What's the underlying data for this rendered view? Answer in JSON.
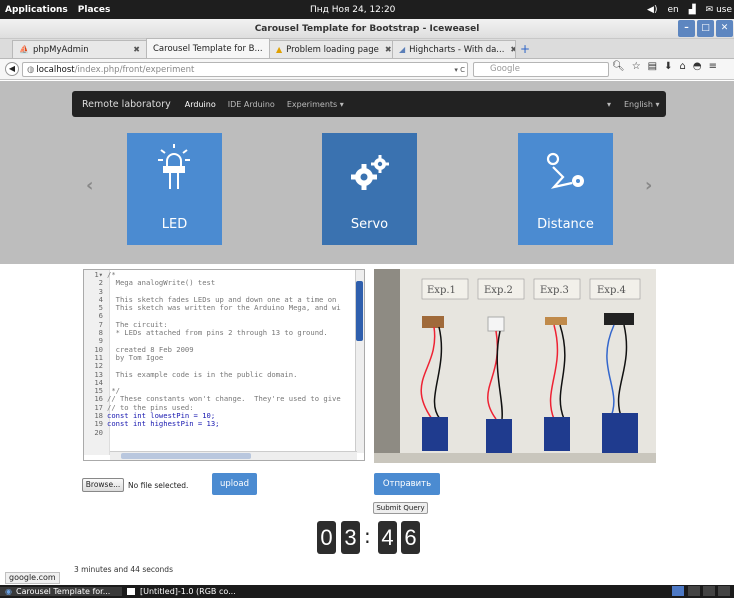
{
  "system_panel": {
    "applications": "Applications",
    "places": "Places",
    "clock": "Пнд Ноя 24, 12:20",
    "lang": "en",
    "user": "use"
  },
  "window": {
    "title": "Carousel Template for Bootstrap - Iceweasel"
  },
  "tabs": [
    {
      "label": "phpMyAdmin"
    },
    {
      "label": "Carousel Template for B..."
    },
    {
      "label": "Problem loading page"
    },
    {
      "label": "Highcharts - With da..."
    }
  ],
  "address_bar": {
    "host": "localhost",
    "path": "/index.php/front/experiment",
    "search_placeholder": "Google"
  },
  "site_nav": {
    "brand": "Remote laboratory",
    "items": [
      "Arduino",
      "IDE Arduino",
      "Experiments"
    ],
    "language": "English"
  },
  "carousel": {
    "cards": [
      {
        "label": "LED",
        "icon": "led-icon"
      },
      {
        "label": "Servo",
        "icon": "gears-icon"
      },
      {
        "label": "Distance",
        "icon": "route-icon"
      }
    ]
  },
  "editor": {
    "lines": [
      "/*",
      "  Mega analogWrite() test",
      "",
      "  This sketch fades LEDs up and down one at a time on",
      "  This sketch was written for the Arduino Mega, and wi",
      "",
      "  The circuit:",
      "  * LEDs attached from pins 2 through 13 to ground.",
      "",
      "  created 8 Feb 2009",
      "  by Tom Igoe",
      "",
      "  This example code is in the public domain.",
      "",
      " */",
      "// These constants won't change.  They're used to give",
      "// to the pins used:",
      "const int lowestPin = 10;",
      "const int highestPin = 13;",
      ""
    ]
  },
  "photo": {
    "labels": [
      "Exp.1",
      "Exp.2",
      "Exp.3",
      "Exp.4"
    ]
  },
  "form": {
    "browse": "Browse...",
    "no_file": "No file selected.",
    "upload": "upload",
    "send": "Отправить",
    "submit_query": "Submit Query"
  },
  "timer": {
    "digits": [
      "0",
      "3",
      "4",
      "6"
    ],
    "text": "3 minutes and 44 seconds"
  },
  "status_bar": "google.com",
  "taskbar": {
    "tasks": [
      "Carousel Template for...",
      "[Untitled]-1.0 (RGB co..."
    ]
  }
}
